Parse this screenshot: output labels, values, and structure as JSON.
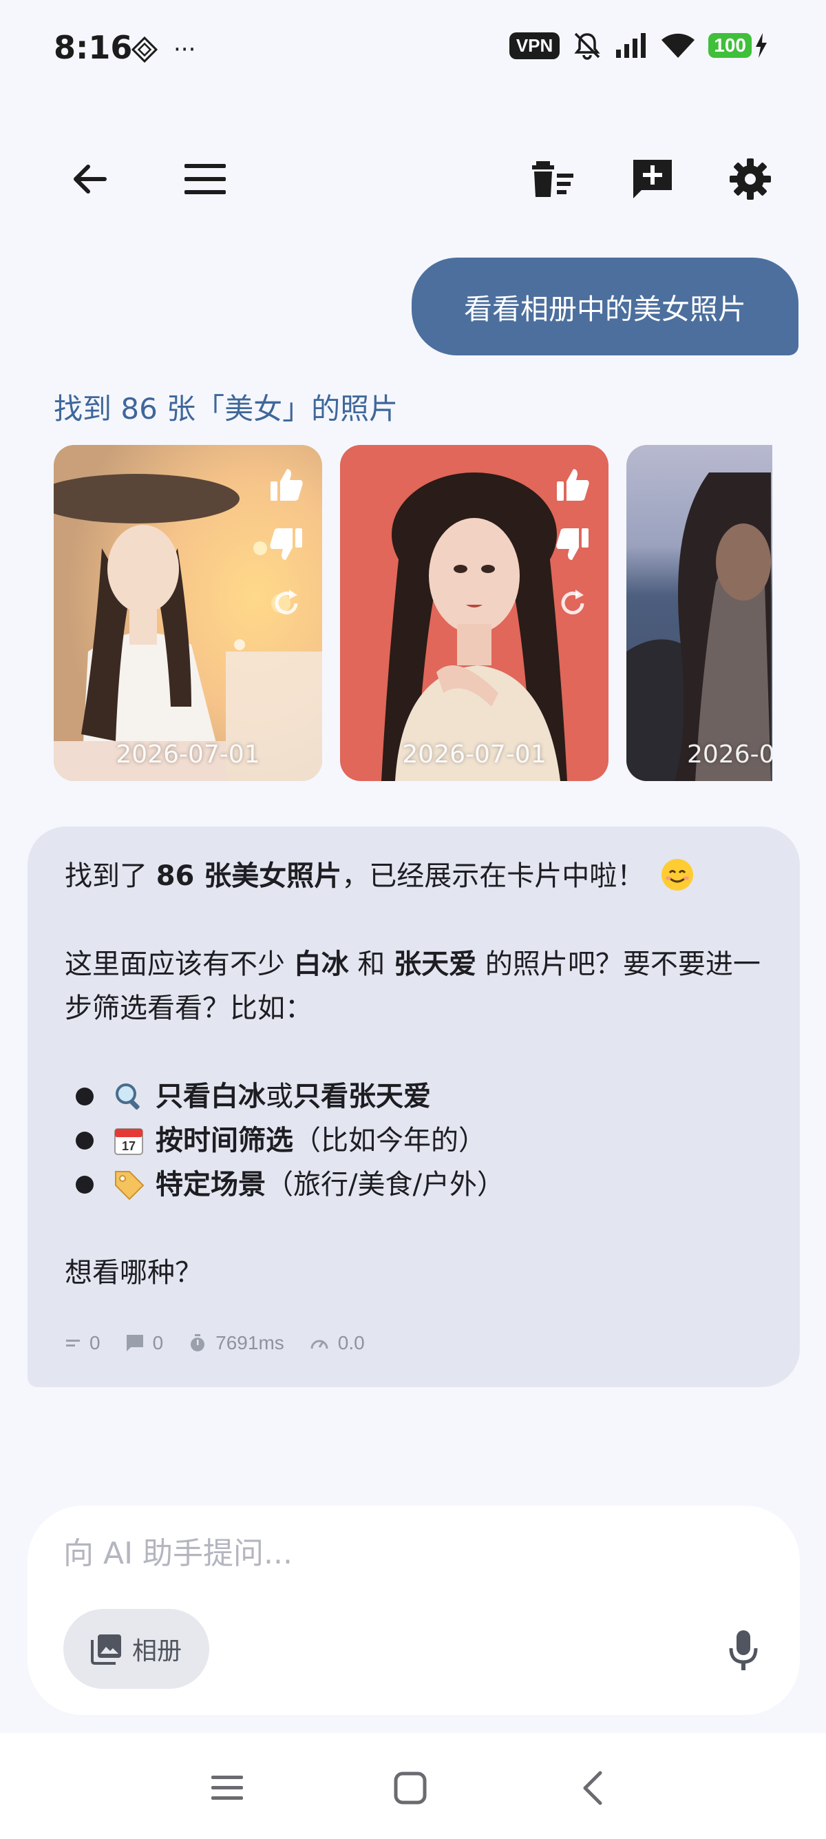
{
  "status_bar": {
    "time": "8:16",
    "more": "···",
    "vpn": "VPN",
    "battery": "100"
  },
  "toolbar": {
    "back_icon": "arrow-left-icon",
    "menu_icon": "hamburger-icon",
    "clear_icon": "delete-sweep-icon",
    "new_chat_icon": "add-comment-icon",
    "settings_icon": "gear-icon"
  },
  "user_message": "看看相册中的美女照片",
  "results": {
    "title": "找到 86 张「美女」的照片",
    "photos": [
      {
        "date": "2026-07-01"
      },
      {
        "date": "2026-07-01"
      },
      {
        "date": "2026-0"
      }
    ]
  },
  "assistant": {
    "line1_pre": "找到了 ",
    "line1_bold": "86 张美女照片",
    "line1_post": "，已经展示在卡片中啦！",
    "line2_a": "这里面应该有不少 ",
    "line2_b": "白冰",
    "line2_c": " 和 ",
    "line2_d": "张天爱",
    "line2_e": " 的照片吧？要不要进一步筛选看看？比如：",
    "bullets": [
      {
        "bold1": "只看白冰",
        "mid": " 或 ",
        "bold2": "只看张天爱",
        "rest": ""
      },
      {
        "bold1": "按时间筛选",
        "mid": "",
        "bold2": "",
        "rest": "（比如今年的）"
      },
      {
        "bold1": "特定场景",
        "mid": "",
        "bold2": "",
        "rest": "（旅行/美食/户外）"
      }
    ],
    "question": "想看哪种？",
    "stats": {
      "tokens": "0",
      "messages": "0",
      "duration": "7691ms",
      "speed": "0.0"
    }
  },
  "input": {
    "placeholder": "向 AI 助手提问...",
    "album_label": "相册"
  },
  "colors": {
    "accent": "#4c6f9e",
    "title_blue": "#3f679a",
    "assistant_bg": "#e3e6f0",
    "page_bg": "#f5f7fd"
  }
}
